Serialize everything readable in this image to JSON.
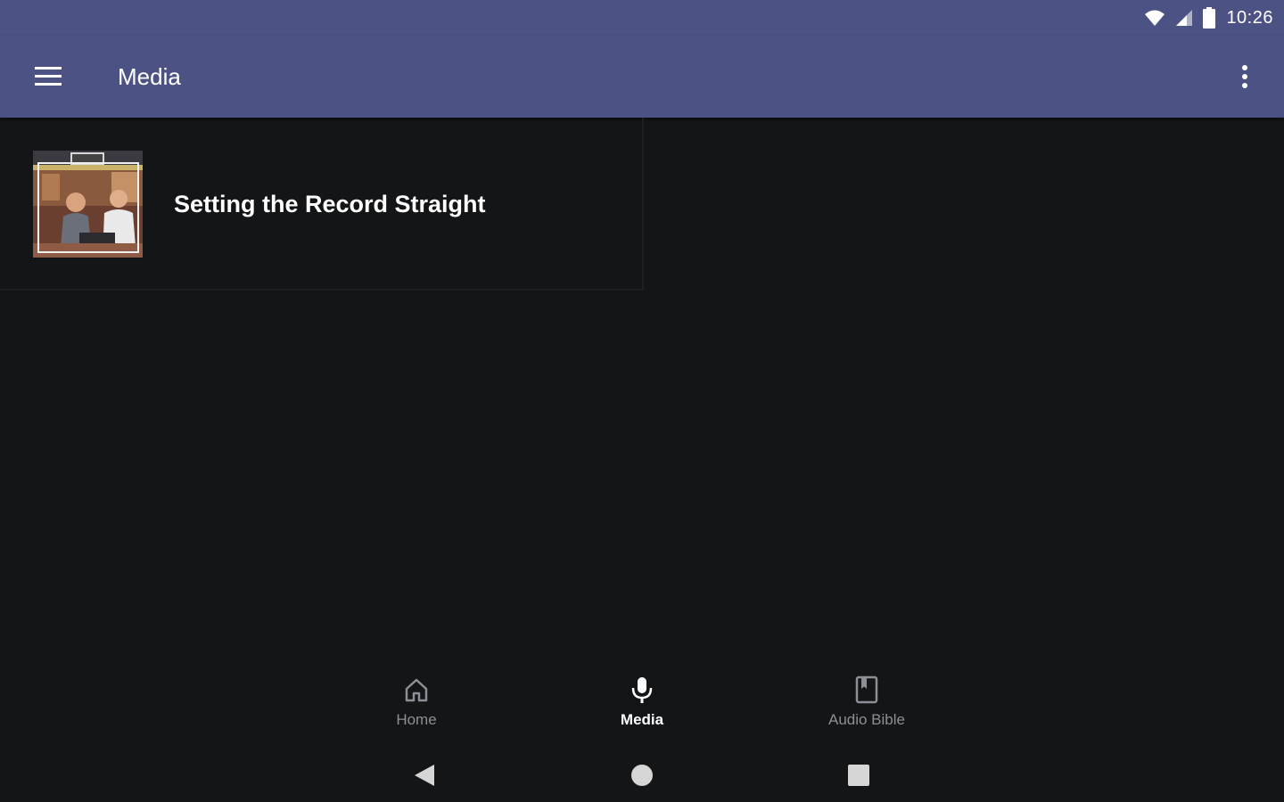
{
  "status_bar": {
    "time": "10:26",
    "icons": [
      "wifi-icon",
      "cell-signal-icon",
      "battery-icon"
    ]
  },
  "app_bar": {
    "title": "Media",
    "menu_icon": "hamburger-menu-icon",
    "overflow_icon": "more-vertical-icon",
    "color": "#4d5285"
  },
  "media_list": {
    "items": [
      {
        "title": "Setting the Record Straight",
        "thumbnail": "media-thumbnail"
      }
    ]
  },
  "bottom_nav": {
    "items": [
      {
        "label": "Home",
        "icon": "home-icon",
        "active": false
      },
      {
        "label": "Media",
        "icon": "microphone-icon",
        "active": true
      },
      {
        "label": "Audio Bible",
        "icon": "book-icon",
        "active": false
      }
    ]
  },
  "system_nav": {
    "icons": [
      "back-icon",
      "home-circle-icon",
      "recents-icon"
    ]
  },
  "colors": {
    "background": "#131517",
    "accent": "#4d5285",
    "inactive_label": "#8c8f95",
    "active_label": "#ffffff"
  }
}
